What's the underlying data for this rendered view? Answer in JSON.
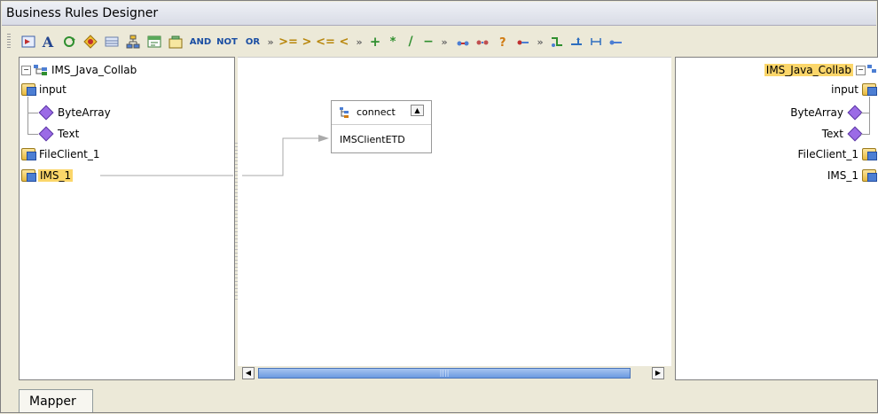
{
  "window": {
    "title": "Business Rules Designer"
  },
  "toolbar": {
    "and_label": "AND",
    "not_label": "NOT",
    "or_label": "OR",
    "ops": [
      "»",
      ">=",
      ">",
      "<=",
      "<",
      "»",
      "+",
      "*",
      "/",
      "−",
      "»",
      "»"
    ],
    "icons": [
      "select-icon",
      "text-A-icon",
      "rotate-icon",
      "badge-icon",
      "table-icon",
      "tree-icon",
      "calendar-icon",
      "layout-icon"
    ]
  },
  "left_tree": {
    "root_label": "IMS_Java_Collab",
    "items": [
      {
        "label": "input",
        "kind": "folder"
      },
      {
        "label": "ByteArray",
        "kind": "leaf"
      },
      {
        "label": "Text",
        "kind": "leaf"
      },
      {
        "label": "FileClient_1",
        "kind": "folder"
      },
      {
        "label": "IMS_1",
        "kind": "folder",
        "selected": true
      }
    ]
  },
  "method_box": {
    "title": "connect",
    "param": "IMSClientETD"
  },
  "right_tree": {
    "root_label": "IMS_Java_Collab",
    "items": [
      {
        "label": "input",
        "kind": "folder"
      },
      {
        "label": "ByteArray",
        "kind": "leaf"
      },
      {
        "label": "Text",
        "kind": "leaf"
      },
      {
        "label": "FileClient_1",
        "kind": "folder"
      },
      {
        "label": "IMS_1",
        "kind": "folder"
      }
    ]
  },
  "tabs": [
    {
      "label": "Mapper"
    }
  ],
  "colors": {
    "highlight": "#fbd66a",
    "scroll_thumb": "#6b9ae0",
    "background": "#ece9d8"
  }
}
